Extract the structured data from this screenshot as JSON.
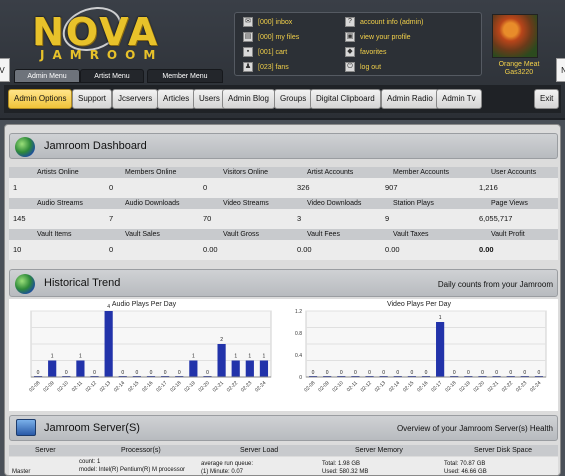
{
  "logo": {
    "word": "NOVA",
    "subword": "JAMROOM"
  },
  "user_panel": {
    "links": [
      {
        "icon": "inbox-icon",
        "label": "[000] inbox"
      },
      {
        "icon": "files-icon",
        "label": "[000] my files"
      },
      {
        "icon": "cart-icon",
        "label": "[001] cart"
      },
      {
        "icon": "fans-icon",
        "label": "[023] fans"
      },
      {
        "icon": "account-icon",
        "label": "account info (admin)"
      },
      {
        "icon": "profile-icon",
        "label": "view your profile"
      },
      {
        "icon": "favorites-icon",
        "label": "favorites"
      },
      {
        "icon": "logout-icon",
        "label": "log out"
      }
    ],
    "avatar_caption": "Orange Meat Gas3220"
  },
  "edge_tabs": {
    "left": "V",
    "right": "N"
  },
  "menu_tabs": [
    "Admin Menu",
    "Artist Menu",
    "Member Menu"
  ],
  "menu_buttons": [
    "Admin Options",
    "Support",
    "Jcservers",
    "Articles",
    "Users",
    "Admin Blog",
    "Groups",
    "Digital Clipboard",
    "Admin Radio",
    "Admin Tv",
    "Exit"
  ],
  "dashboard": {
    "title": "Jamroom Dashboard",
    "rows": [
      {
        "labels": [
          "Artists Online",
          "Members Online",
          "Visitors Online",
          "Artist Accounts",
          "Member Accounts",
          "User Accounts"
        ],
        "values": [
          "1",
          "0",
          "0",
          "326",
          "907",
          "1,216"
        ]
      },
      {
        "labels": [
          "Audio Streams",
          "Audio Downloads",
          "Video Streams",
          "Video Downloads",
          "Station Plays",
          "Page Views"
        ],
        "values": [
          "145",
          "7",
          "70",
          "3",
          "9",
          "6,055,717"
        ]
      },
      {
        "labels": [
          "Vault Items",
          "Vault Sales",
          "Vault Gross",
          "Vault Fees",
          "Vault Taxes",
          "Vault Profit"
        ],
        "values": [
          "10",
          "0",
          "0.00",
          "0.00",
          "0.00",
          "0.00"
        ]
      }
    ]
  },
  "trend": {
    "title": "Historical Trend",
    "subtitle": "Daily counts from your Jamroom"
  },
  "chart_data": [
    {
      "type": "bar",
      "title": "Audio Plays Per Day",
      "categories": [
        "02-08",
        "02-09",
        "02-10",
        "02-11",
        "02-12",
        "02-13",
        "02-14",
        "02-15",
        "02-16",
        "02-17",
        "02-18",
        "02-19",
        "02-20",
        "02-21",
        "02-22",
        "02-23",
        "02-24"
      ],
      "values": [
        0,
        1,
        0,
        1,
        0,
        4,
        0,
        0,
        0,
        0,
        0,
        1,
        0,
        2,
        1,
        1,
        1
      ],
      "ylim": [
        0,
        4
      ],
      "yticks": [],
      "color": "#2233aa"
    },
    {
      "type": "bar",
      "title": "Video Plays Per Day",
      "categories": [
        "02-08",
        "02-09",
        "02-10",
        "02-11",
        "02-12",
        "02-13",
        "02-14",
        "02-15",
        "02-16",
        "02-17",
        "02-18",
        "02-19",
        "02-20",
        "02-21",
        "02-22",
        "02-23",
        "02-24"
      ],
      "values": [
        0,
        0,
        0,
        0,
        0,
        0,
        0,
        0,
        0,
        1,
        0,
        0,
        0,
        0,
        0,
        0,
        0
      ],
      "ylim": [
        0,
        1.2
      ],
      "yticks": [
        "0",
        "0.4",
        "0.8",
        "1.2"
      ],
      "color": "#2233aa"
    }
  ],
  "servers": {
    "title": "Jamroom Server(S)",
    "subtitle": "Overview of your Jamroom Server(s) Health",
    "columns": [
      "Server",
      "Processor(s)",
      "Server Load",
      "Server Memory",
      "Server Disk Space"
    ],
    "row": {
      "server": "Master",
      "processor": [
        "count: 1",
        "model: Intel(R) Pentium(R) M processor"
      ],
      "load": [
        "average run queue:",
        "(1) Minute: 0.07"
      ],
      "memory": [
        "Total: 1.98 GB",
        "Used: 580.32 MB"
      ],
      "disk": [
        "Total: 70.87 GB",
        "Used: 46.66 GB"
      ]
    }
  },
  "colors": {
    "accent": "#f2d04a",
    "bar": "#2233aa",
    "active_button": "#f0c43a"
  }
}
